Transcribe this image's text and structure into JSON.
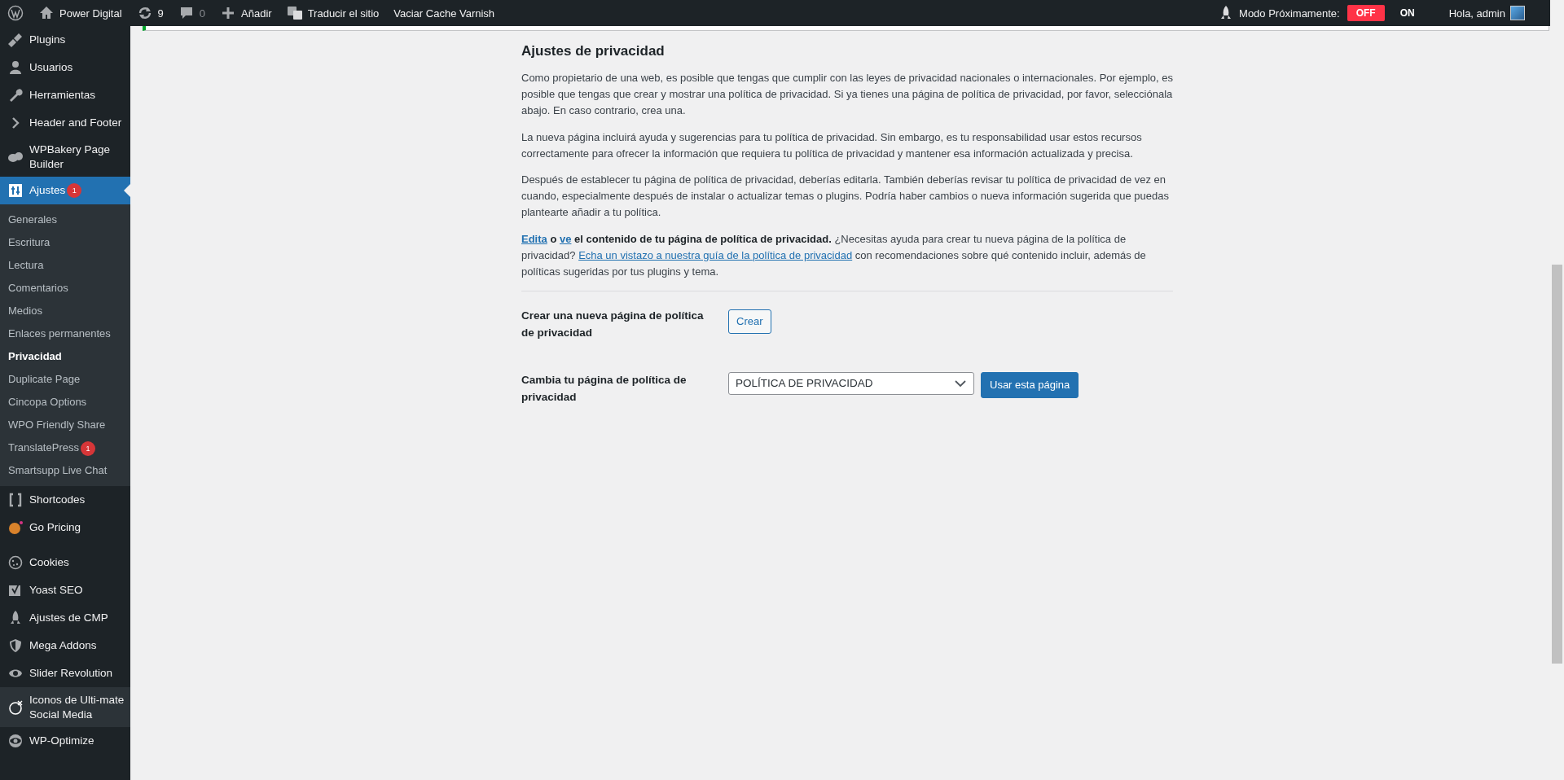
{
  "admin_bar": {
    "site_name": "Power Digital",
    "updates_count": "9",
    "comments_count": "0",
    "new_label": "Añadir",
    "translate_label": "Traducir el sitio",
    "cache_label": "Vaciar Cache Varnish",
    "coming_soon_label": "Modo Próximamente:",
    "coming_soon_toggle": [
      {
        "label": "OFF",
        "selected": true
      },
      {
        "label": "ON",
        "selected": false
      }
    ],
    "greeting": "Hola, admin"
  },
  "sidebar": {
    "items": [
      {
        "label": "Plugins",
        "selected": false,
        "hovered": false
      },
      {
        "label": "Usuarios",
        "selected": false,
        "hovered": false
      },
      {
        "label": "Herramientas",
        "selected": false,
        "hovered": false
      },
      {
        "label": "Header and Footer",
        "selected": false,
        "hovered": false
      },
      {
        "label": "WPBakery Page Builder",
        "selected": false,
        "hovered": false
      },
      {
        "label": "Ajustes",
        "badge": "1",
        "selected": true,
        "hovered": false,
        "children": [
          {
            "label": "Generales",
            "selected": false
          },
          {
            "label": "Escritura",
            "selected": false
          },
          {
            "label": "Lectura",
            "selected": false
          },
          {
            "label": "Comentarios",
            "selected": false
          },
          {
            "label": "Medios",
            "selected": false
          },
          {
            "label": "Enlaces permanentes",
            "selected": false
          },
          {
            "label": "Privacidad",
            "selected": true
          },
          {
            "label": "Duplicate Page",
            "selected": false
          },
          {
            "label": "Cincopa Options",
            "selected": false
          },
          {
            "label": "WPO Friendly Share",
            "selected": false
          },
          {
            "label": "TranslatePress",
            "badge": "1",
            "selected": false
          },
          {
            "label": "Smartsupp Live Chat",
            "selected": false
          }
        ]
      },
      {
        "label": "Shortcodes",
        "selected": false,
        "hovered": false
      },
      {
        "label": "Go Pricing",
        "selected": false,
        "hovered": false
      },
      {
        "label": "Cookies",
        "selected": false,
        "hovered": false,
        "separator_before": true
      },
      {
        "label": "Yoast SEO",
        "selected": false,
        "hovered": false
      },
      {
        "label": "Ajustes de CMP",
        "selected": false,
        "hovered": false
      },
      {
        "label": "Mega Addons",
        "selected": false,
        "hovered": false
      },
      {
        "label": "Slider Revolution",
        "selected": false,
        "hovered": false
      },
      {
        "label": "Iconos de Ulti-mate Social Media",
        "selected": false,
        "hovered": true
      },
      {
        "label": "WP-Optimize",
        "selected": false,
        "hovered": false
      }
    ]
  },
  "content": {
    "title": "Ajustes de privacidad",
    "paragraphs": [
      "Como propietario de una web, es posible que tengas que cumplir con las leyes de privacidad nacionales o internacionales. Por ejemplo, es posible que tengas que crear y mostrar una política de privacidad. Si ya tienes una página de política de privacidad, por favor, selecciónala abajo. En caso contrario, crea una.",
      "La nueva página incluirá ayuda y sugerencias para tu política de privacidad. Sin embargo, es tu responsabilidad usar estos recursos correctamente para ofrecer la información que requiera tu política de privacidad y mantener esa información actualizada y precisa.",
      "Después de establecer tu página de política de privacidad, deberías editarla. También deberías revisar tu política de privacidad de vez en cuando, especialmente después de instalar o actualizar temas o plugins. Podría haber cambios o nueva información sugerida que puedas plantearte añadir a tu política."
    ],
    "help": {
      "edit_link": "Edita",
      "connector": "o",
      "view_link": "ve",
      "bold_text": "el contenido de tu página de política de privacidad.",
      "question": "¿Necesitas ayuda para crear tu nueva página de la política de privacidad?",
      "guide_link": "Echa un vistazo a nuestra guía de la política de privacidad",
      "after_link": "con recomendaciones sobre qué contenido incluir, además de políticas sugeridas por tus plugins y tema."
    },
    "create_row": {
      "label": "Crear una nueva página de política de privacidad",
      "button": "Crear"
    },
    "change_row": {
      "label": "Cambia tu página de política de privacidad",
      "select_value": "POLÍTICA DE PRIVACIDAD",
      "button": "Usar esta página"
    }
  }
}
